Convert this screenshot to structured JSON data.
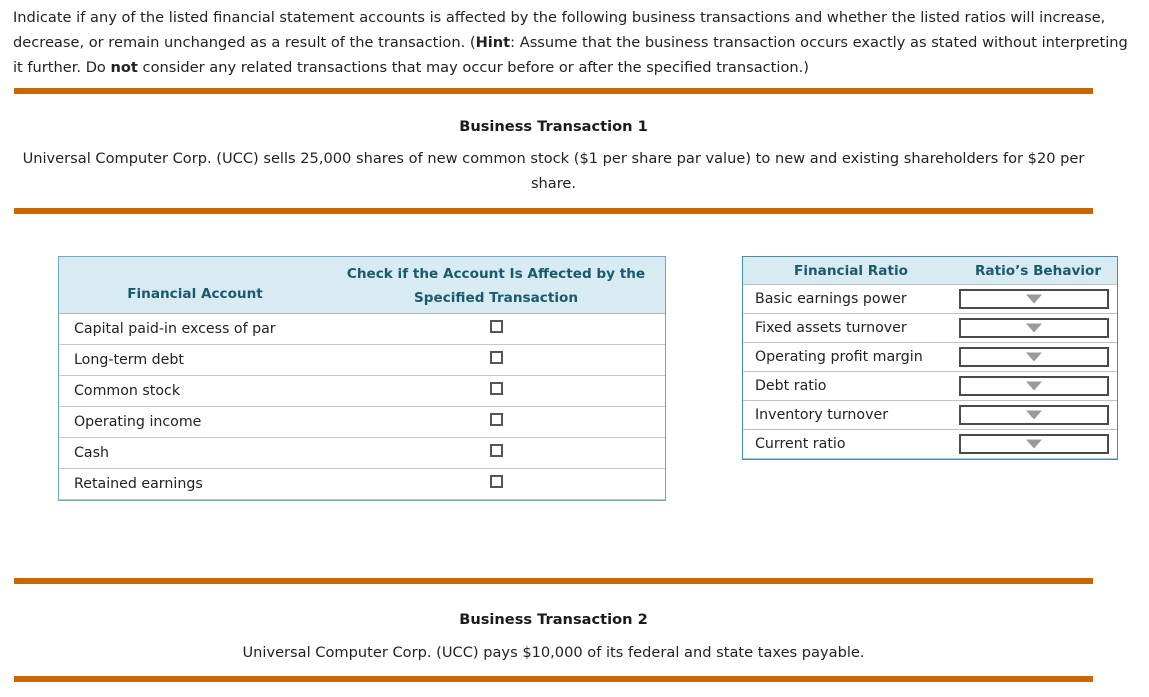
{
  "intro": {
    "part1": "Indicate if any of the listed financial statement accounts is affected by the following business transactions and whether the listed ratios will increase, decrease, or remain unchanged as a result of the transaction. (",
    "hint_label": "Hint",
    "part2": ": Assume that the business transaction occurs exactly as stated without interpreting it further. Do ",
    "not_label": "not",
    "part3": " consider any related transactions that may occur before or after the specified transaction.)"
  },
  "transaction1": {
    "title": "Business Transaction 1",
    "body": "Universal Computer Corp. (UCC) sells 25,000 shares of new common stock ($1 per share par value) to new and existing shareholders for $20 per share."
  },
  "transaction2": {
    "title": "Business Transaction 2",
    "body": "Universal Computer Corp. (UCC) pays $10,000 of its federal and state taxes payable."
  },
  "account_table": {
    "header_account": "Financial Account",
    "header_check": "Check if the Account Is Affected by the Specified Transaction",
    "header_check_line1": "Check if the Account Is Affected by the",
    "header_check_line2": "Specified Transaction",
    "rows": [
      {
        "label": "Capital paid-in excess of par",
        "checked": false
      },
      {
        "label": "Long-term debt",
        "checked": false
      },
      {
        "label": "Common stock",
        "checked": false
      },
      {
        "label": "Operating income",
        "checked": false
      },
      {
        "label": "Cash",
        "checked": false
      },
      {
        "label": "Retained earnings",
        "checked": false
      }
    ]
  },
  "ratio_table": {
    "header_ratio": "Financial Ratio",
    "header_behavior": "Ratio’s Behavior",
    "rows": [
      {
        "label": "Basic earnings power",
        "value": ""
      },
      {
        "label": "Fixed assets turnover",
        "value": ""
      },
      {
        "label": "Operating profit margin",
        "value": ""
      },
      {
        "label": "Debt ratio",
        "value": ""
      },
      {
        "label": "Inventory turnover",
        "value": ""
      },
      {
        "label": "Current ratio",
        "value": ""
      }
    ]
  },
  "colors": {
    "rule_orange": "#cc6600",
    "table_border_blue": "#3f8fb8",
    "header_fill": "#d8eaf2",
    "header_text": "#1a5a6e"
  }
}
